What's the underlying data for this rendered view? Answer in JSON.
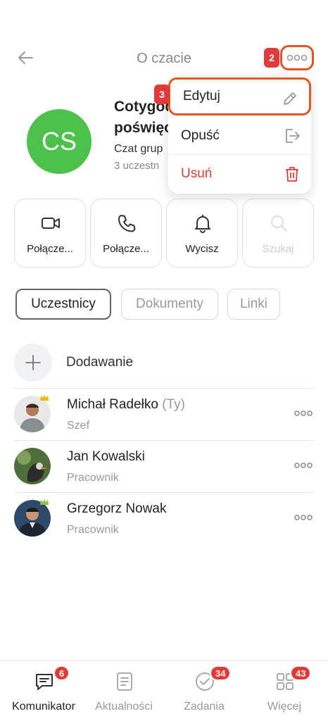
{
  "header": {
    "title": "O czacie",
    "back_icon": "arrow-left-icon",
    "more_icon": "more-dots-icon",
    "step_badge": "2"
  },
  "chat": {
    "initials": "CS",
    "name_line1": "Cotygod",
    "name_line2": "poświęc",
    "type": "Czat grup",
    "members": "3 uczestn",
    "avatar_color": "#4cc24a"
  },
  "menu": {
    "step_badge": "3",
    "edit": "Edytuj",
    "leave": "Opuść",
    "delete": "Usuń",
    "delete_color": "#e53935",
    "highlight_color": "#e8541e"
  },
  "actions": [
    {
      "label": "Połącze...",
      "icon": "video-icon"
    },
    {
      "label": "Połącze...",
      "icon": "phone-icon"
    },
    {
      "label": "Wycisz",
      "icon": "bell-icon"
    },
    {
      "label": "Szukaj",
      "icon": "search-icon"
    }
  ],
  "tabs": [
    {
      "label": "Uczestnicy",
      "active": true
    },
    {
      "label": "Dokumenty",
      "active": false
    },
    {
      "label": "Linki",
      "active": false
    }
  ],
  "add_label": "Dodawanie",
  "members": [
    {
      "name": "Michał Radełko",
      "suffix": "(Ty)",
      "role": "Szef"
    },
    {
      "name": "Jan Kowalski",
      "suffix": "",
      "role": "Pracownik"
    },
    {
      "name": "Grzegorz Nowak",
      "suffix": "",
      "role": "Pracownik"
    }
  ],
  "nav": [
    {
      "label": "Komunikator",
      "badge": "6",
      "icon": "chat-icon"
    },
    {
      "label": "Aktualności",
      "badge": "",
      "icon": "news-icon"
    },
    {
      "label": "Zadania",
      "badge": "34",
      "icon": "check-circle-icon"
    },
    {
      "label": "Więcej",
      "badge": "43",
      "icon": "grid-icon"
    }
  ]
}
